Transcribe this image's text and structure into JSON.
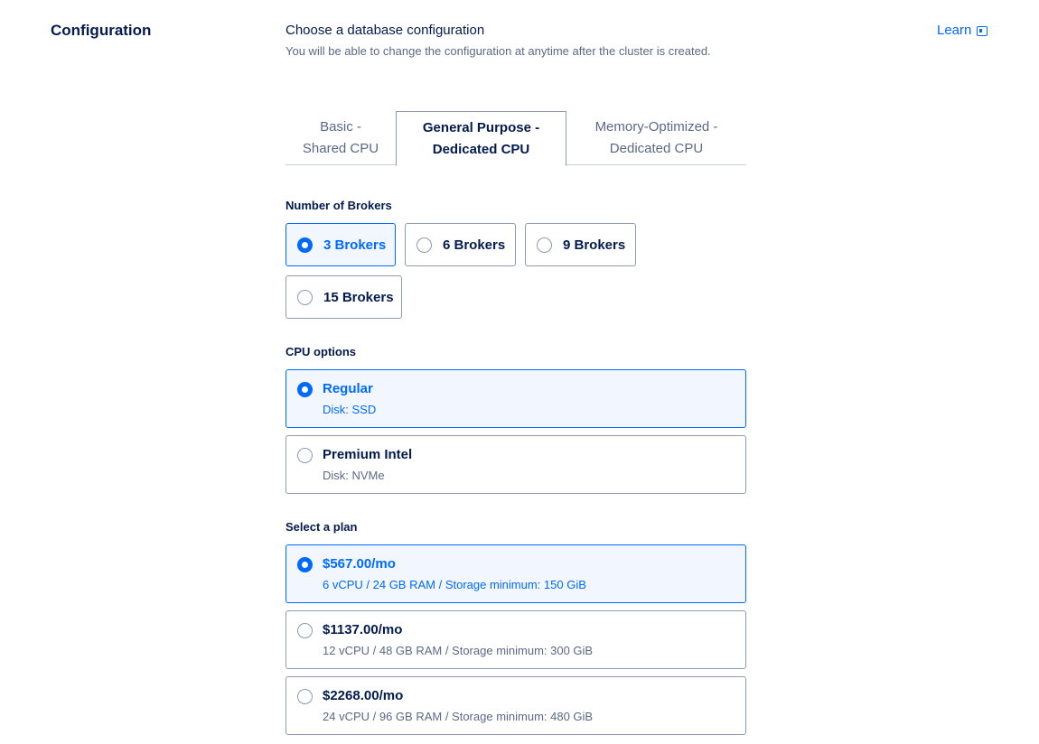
{
  "section": {
    "title": "Configuration"
  },
  "header": {
    "title": "Choose a database configuration",
    "subtitle": "You will be able to change the configuration at anytime after the cluster is created.",
    "learn_label": "Learn"
  },
  "tabs": [
    {
      "line1": "Basic -",
      "line2": "Shared CPU",
      "selected": false
    },
    {
      "line1": "General Purpose -",
      "line2": "Dedicated CPU",
      "selected": true
    },
    {
      "line1": "Memory-Optimized -",
      "line2": "Dedicated CPU",
      "selected": false
    }
  ],
  "brokers": {
    "label": "Number of Brokers",
    "options": [
      {
        "label": "3 Brokers",
        "selected": true
      },
      {
        "label": "6 Brokers",
        "selected": false
      },
      {
        "label": "9 Brokers",
        "selected": false
      },
      {
        "label": "15 Brokers",
        "selected": false
      }
    ]
  },
  "cpu": {
    "label": "CPU options",
    "options": [
      {
        "title": "Regular",
        "sub": "Disk: SSD",
        "selected": true
      },
      {
        "title": "Premium Intel",
        "sub": "Disk: NVMe",
        "selected": false
      }
    ]
  },
  "plans": {
    "label": "Select a plan",
    "options": [
      {
        "title": "$567.00/mo",
        "sub": "6 vCPU / 24 GB RAM / Storage minimum: 150 GiB",
        "selected": true
      },
      {
        "title": "$1137.00/mo",
        "sub": "12 vCPU / 48 GB RAM / Storage minimum: 300 GiB",
        "selected": false
      },
      {
        "title": "$2268.00/mo",
        "sub": "24 vCPU / 96 GB RAM / Storage minimum: 480 GiB",
        "selected": false
      }
    ]
  },
  "colors": {
    "accent": "#0069ff",
    "text": "#031b4e",
    "muted": "#5b6987",
    "border": "#8e9ab0",
    "selected_bg": "#f2f7ff"
  }
}
